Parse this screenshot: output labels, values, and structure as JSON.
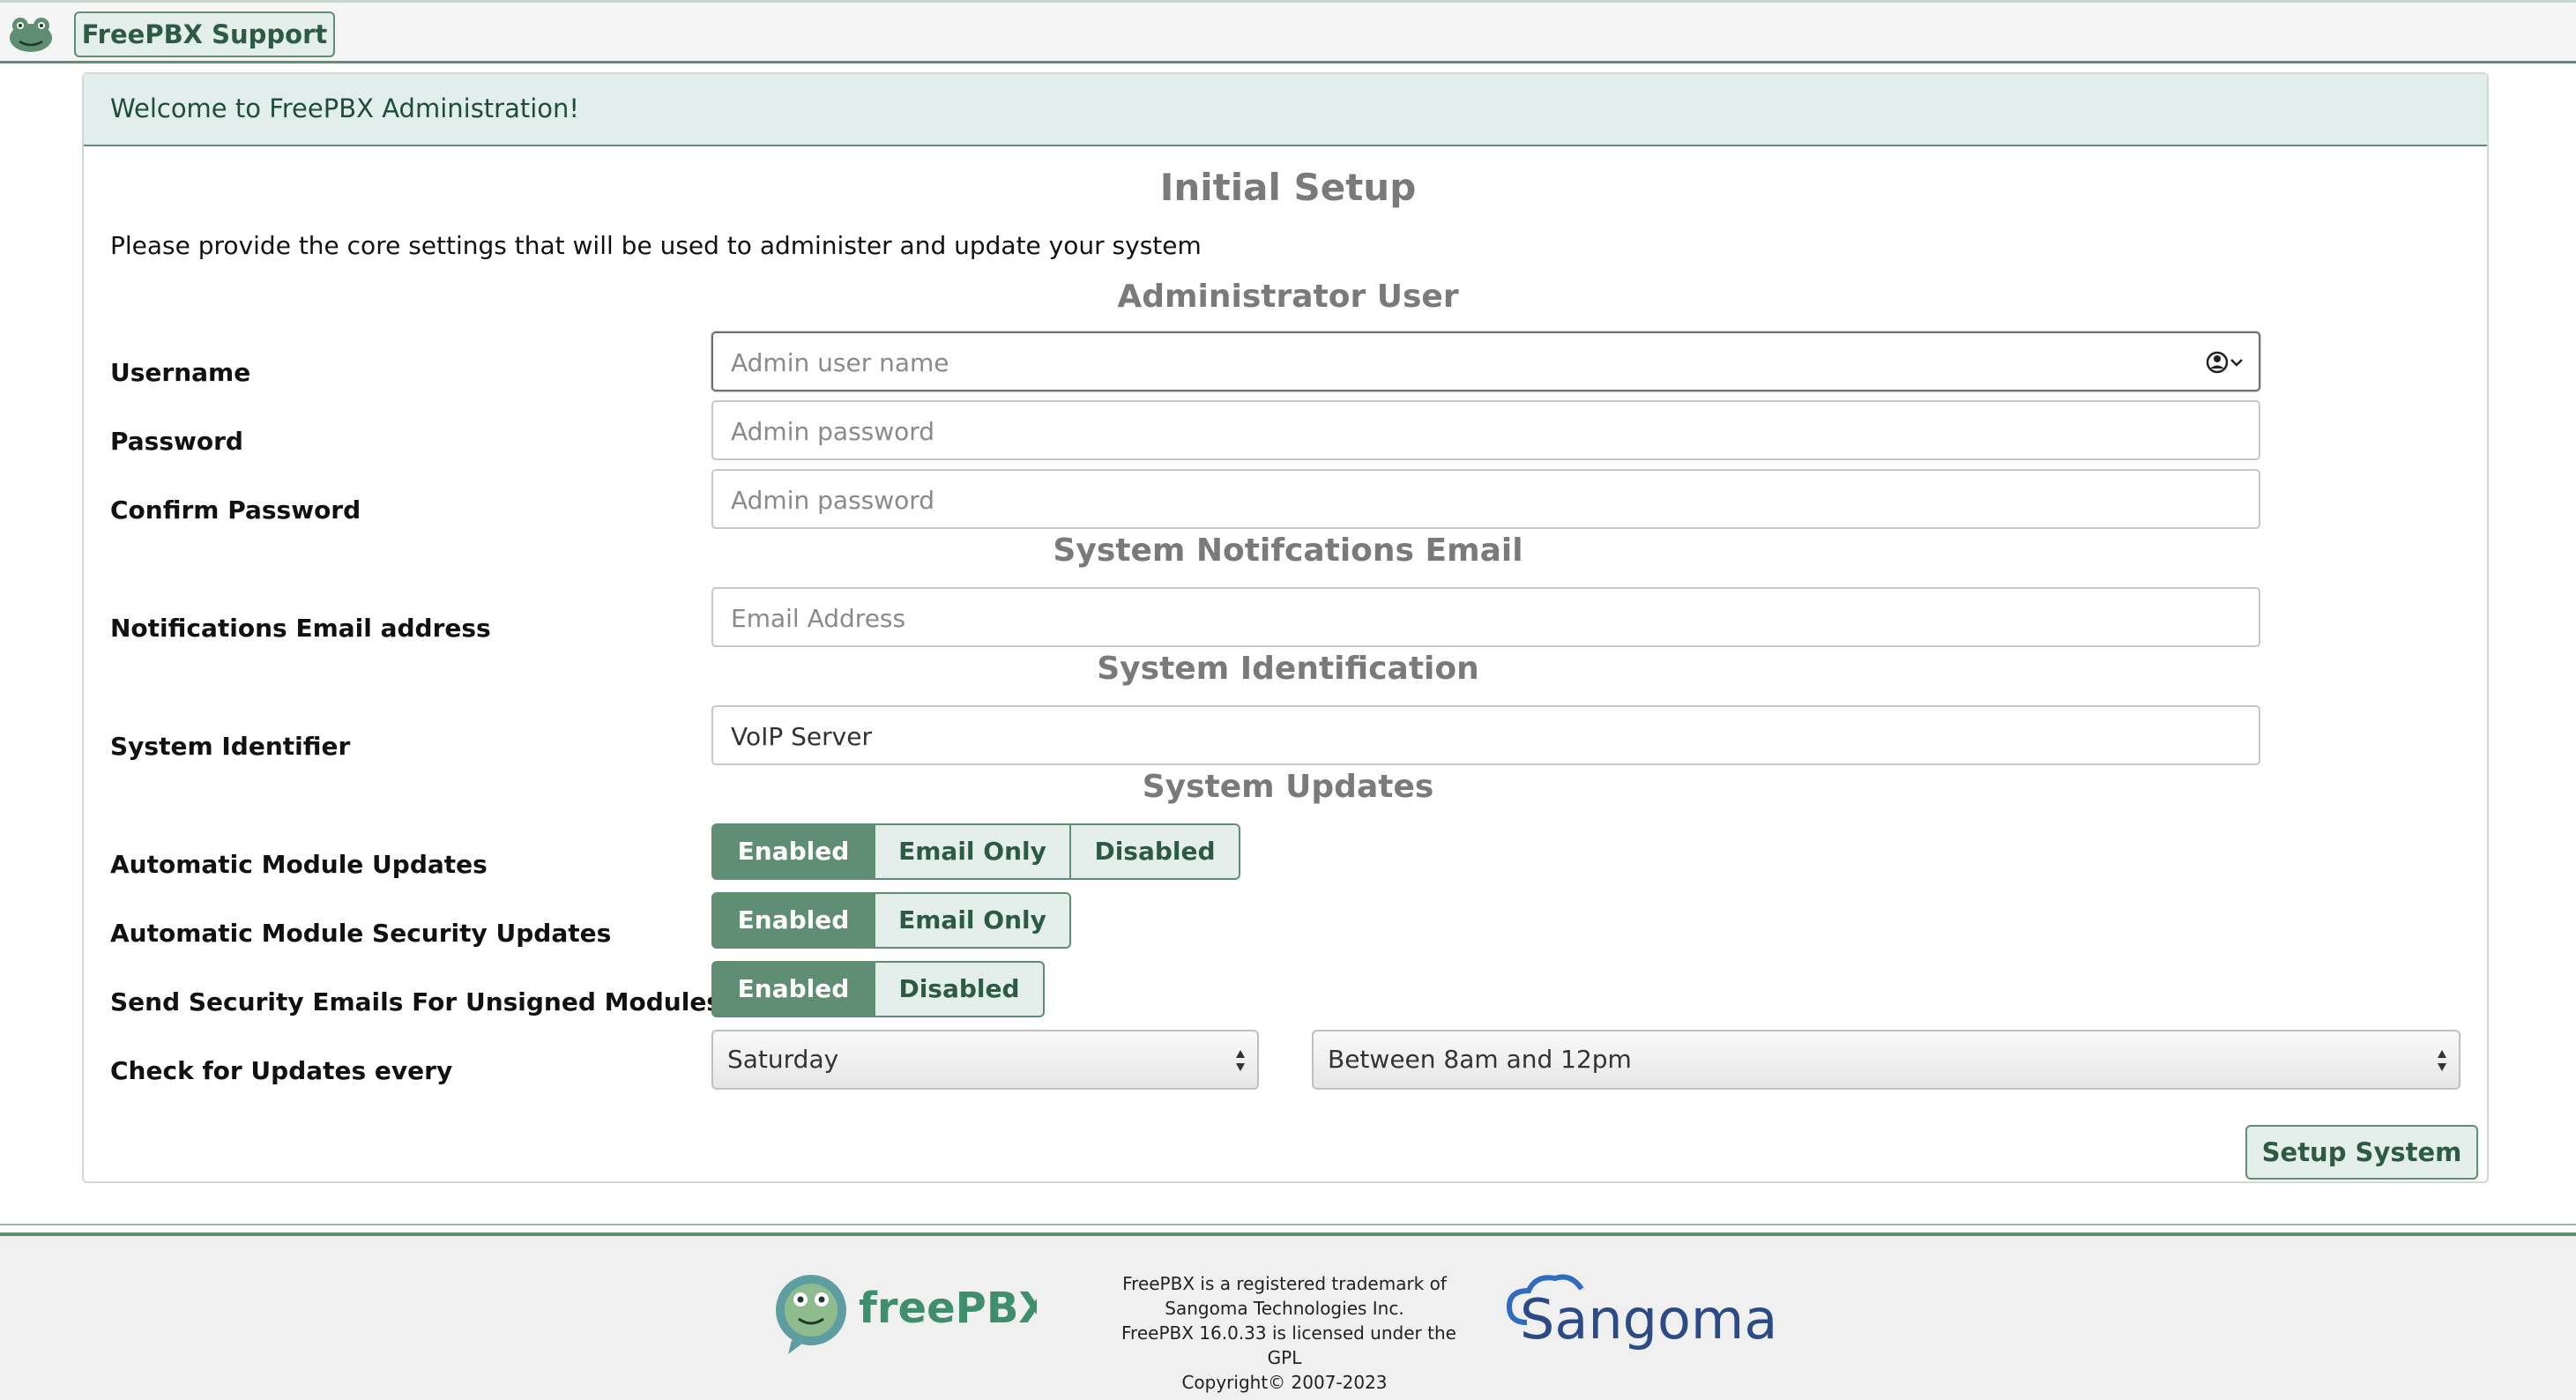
{
  "topbar": {
    "support_label": "FreePBX Support"
  },
  "panel": {
    "welcome": "Welcome to FreePBX Administration!"
  },
  "page": {
    "title": "Initial Setup",
    "intro": "Please provide the core settings that will be used to administer and update your system"
  },
  "sections": {
    "admin": "Administrator User",
    "email": "System Notifcations Email",
    "identification": "System Identification",
    "updates": "System Updates"
  },
  "fields": {
    "username": {
      "label": "Username",
      "placeholder": "Admin user name",
      "value": ""
    },
    "password": {
      "label": "Password",
      "placeholder": "Admin password",
      "value": ""
    },
    "confirm": {
      "label": "Confirm Password",
      "placeholder": "Admin password",
      "value": ""
    },
    "email": {
      "label": "Notifications Email address",
      "placeholder": "Email Address",
      "value": ""
    },
    "identifier": {
      "label": "System Identifier",
      "placeholder": "",
      "value": "VoIP Server"
    }
  },
  "updates": {
    "module": {
      "label": "Automatic Module Updates",
      "options": [
        "Enabled",
        "Email Only",
        "Disabled"
      ],
      "selected": "Enabled"
    },
    "security": {
      "label": "Automatic Module Security Updates",
      "options": [
        "Enabled",
        "Email Only"
      ],
      "selected": "Enabled"
    },
    "unsigned": {
      "label": "Send Security Emails For Unsigned Modules",
      "options": [
        "Enabled",
        "Disabled"
      ],
      "selected": "Enabled"
    },
    "check": {
      "label": "Check for Updates every",
      "day": "Saturday",
      "time": "Between 8am and 12pm"
    }
  },
  "setup_button": "Setup System",
  "footer": {
    "lines": [
      "FreePBX is a registered trademark of",
      "Sangoma Technologies Inc.",
      "FreePBX 16.0.33 is licensed under the",
      "GPL",
      "Copyright© 2007-2023"
    ],
    "freepbx_logo_text": "freePBX",
    "sangoma_logo_text": "Sangoma"
  },
  "colors": {
    "accent": "#5f8e74",
    "accent_light": "#e4efeb",
    "header_bg": "#e2eeeb",
    "text_dark_green": "#2d5a44"
  },
  "icons": {
    "top_logo": "freepbx-frog-icon",
    "autofill": "contact-autofill-icon",
    "select_arrows": "select-arrows-icon"
  }
}
